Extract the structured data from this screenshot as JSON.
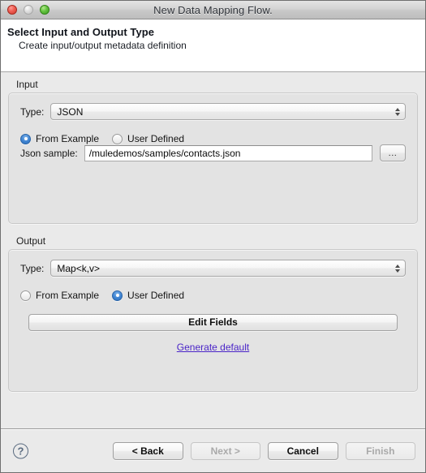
{
  "window": {
    "title": "New Data Mapping Flow.",
    "controls": {
      "close": "close-button",
      "minimize": "minimize-button",
      "zoom": "zoom-button"
    }
  },
  "header": {
    "title": "Select Input and Output Type",
    "subtitle": "Create input/output metadata definition"
  },
  "input": {
    "group_label": "Input",
    "type_label": "Type:",
    "type_value": "JSON",
    "source_options": [
      {
        "label": "From Example",
        "selected": true
      },
      {
        "label": "User Defined",
        "selected": false
      }
    ],
    "sample_label": "Json sample:",
    "sample_value": "/muledemos/samples/contacts.json",
    "sample_placeholder": "",
    "browse_label": "..."
  },
  "output": {
    "group_label": "Output",
    "type_label": "Type:",
    "type_value": "Map<k,v>",
    "source_options": [
      {
        "label": "From Example",
        "selected": false
      },
      {
        "label": "User Defined",
        "selected": true
      }
    ],
    "edit_fields_label": "Edit Fields",
    "generate_default_label": "Generate default"
  },
  "footer": {
    "help_label": "?",
    "buttons": [
      {
        "label": "< Back",
        "enabled": true
      },
      {
        "label": "Next >",
        "enabled": false
      },
      {
        "label": "Cancel",
        "enabled": true
      },
      {
        "label": "Finish",
        "enabled": false
      }
    ]
  },
  "colors": {
    "window_bg": "#eaeaea",
    "group_bg": "#e3e3e3",
    "header_bg": "#ffffff",
    "accent_radio": "#3f84d2",
    "link": "#4a24c8",
    "deco_blue": "#dce4f2"
  }
}
